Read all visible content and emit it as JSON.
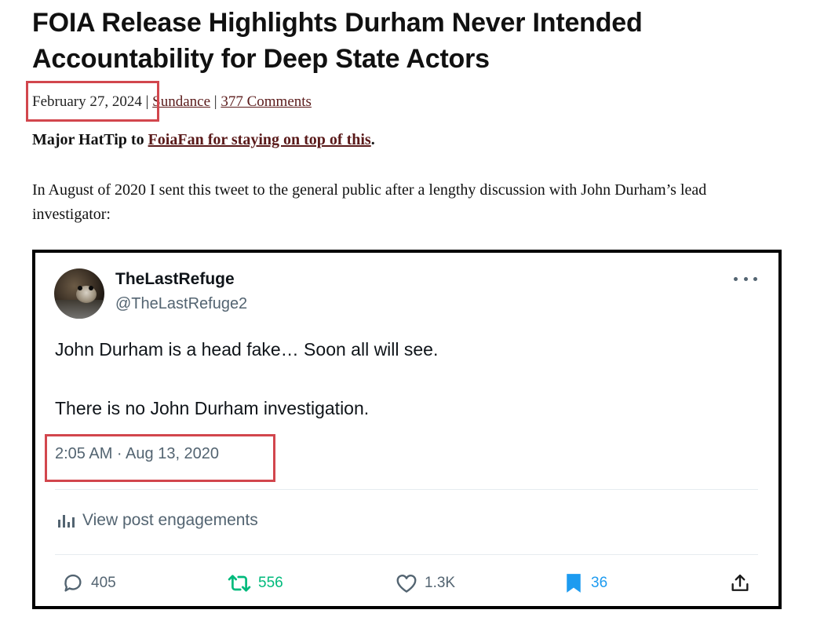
{
  "article": {
    "headline": "FOIA Release Highlights Durham Never Intended Accountability for Deep State Actors",
    "date": "February 27, 2024",
    "separator": "|",
    "author": "Sundance",
    "comments": "377 Comments",
    "hattip_prefix": "Major HatTip to ",
    "hattip_link": "FoiaFan for staying on top of this",
    "hattip_suffix": ".",
    "paragraph": "In August of 2020 I sent this tweet to the general public after a lengthy discussion with John Durham’s lead investigator:"
  },
  "tweet": {
    "display_name": "TheLastRefuge",
    "handle": "@TheLastRefuge2",
    "text_line_1": "John Durham is a head fake…  Soon all will see.",
    "text_line_2": "There is no John Durham investigation.",
    "timestamp": "2:05 AM · Aug 13, 2020",
    "engagements_label": "View post engagements",
    "replies": "405",
    "reposts": "556",
    "likes": "1.3K",
    "bookmarks": "36"
  },
  "colors": {
    "highlight_box": "#d2464d",
    "link": "#5a1a1a",
    "repost_green": "#00ba7c",
    "bookmark_blue": "#1d9bf0",
    "secondary_gray": "#536471"
  },
  "icons": [
    "more-icon",
    "bar-chart-icon",
    "reply-icon",
    "repost-icon",
    "like-icon",
    "bookmark-icon",
    "share-icon"
  ]
}
